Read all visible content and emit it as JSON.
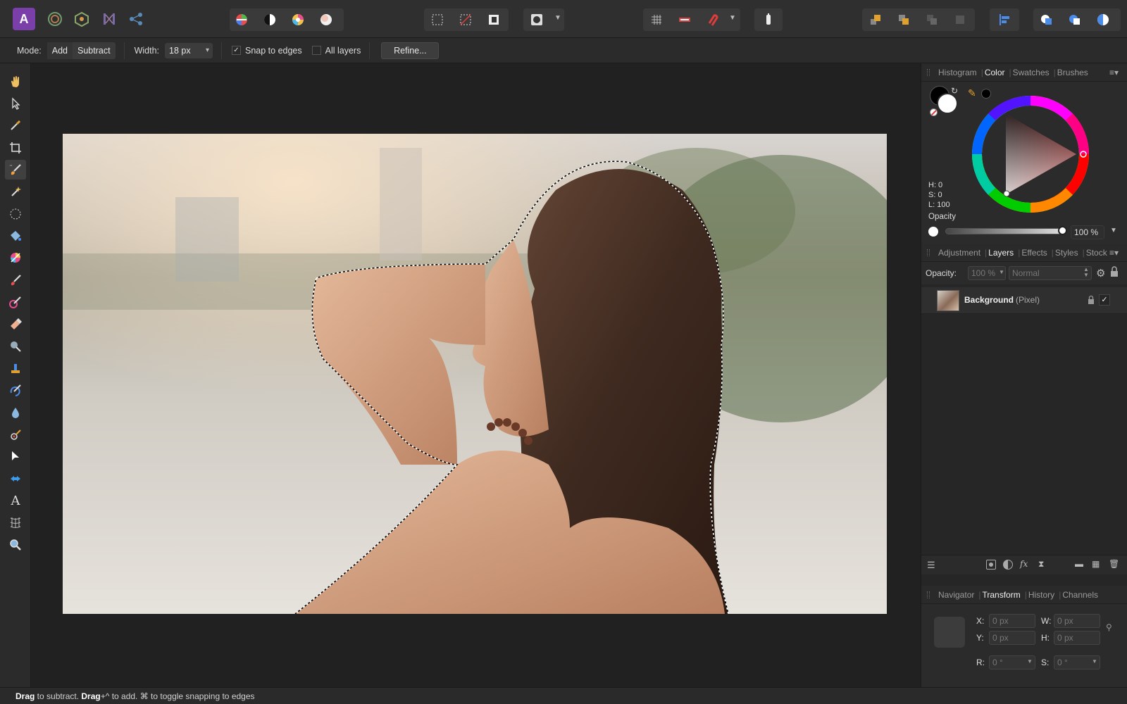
{
  "app": {
    "logo": "A",
    "logo_icon": "affinity-photo-logo"
  },
  "toolbar": {
    "personas": [
      "photo-persona-icon",
      "liquify-persona-icon",
      "develop-persona-icon",
      "tone-mapping-persona-icon",
      "export-persona-icon"
    ],
    "adjust": [
      "auto-levels-icon",
      "auto-contrast-icon",
      "auto-colors-icon",
      "auto-white-balance-icon"
    ],
    "selection": [
      "marquee-icon",
      "deselect-icon",
      "invert-selection-icon"
    ],
    "mask": [
      "quick-mask-icon"
    ],
    "snap": [
      "grid-icon",
      "snapping-ruler-icon",
      "snapping-magnet-icon"
    ],
    "assistant": [
      "assistant-icon"
    ],
    "arrange": [
      "move-to-front-icon",
      "move-forward-icon",
      "move-back-icon",
      "move-to-back-icon"
    ],
    "align": [
      "align-icon"
    ],
    "boolean": [
      "add-icon",
      "subtract-icon",
      "intersect-icon"
    ]
  },
  "context": {
    "mode_label": "Mode:",
    "mode_add": "Add",
    "mode_subtract": "Subtract",
    "width_label": "Width:",
    "width_value": "18 px",
    "snap_label": "Snap to edges",
    "all_layers_label": "All layers",
    "refine_label": "Refine..."
  },
  "tools": [
    "hand-icon",
    "move-icon",
    "color-picker-icon",
    "crop-icon",
    "selection-brush-icon",
    "flood-select-icon",
    "marquee-icon",
    "flood-fill-icon",
    "gradient-icon",
    "paint-brush-icon",
    "color-replacement-icon",
    "erase-brush-icon",
    "dodge-icon",
    "clone-icon",
    "undo-brush-icon",
    "blur-brush-icon",
    "red-eye-icon",
    "node-icon",
    "inpainting-icon",
    "text-icon",
    "mesh-warp-icon",
    "zoom-icon"
  ],
  "panels": {
    "top_tabs": [
      "Histogram",
      "Color",
      "Swatches",
      "Brushes"
    ],
    "top_active": "Color",
    "color": {
      "h": "H: 0",
      "s": "S: 0",
      "l": "L: 100",
      "opacity_label": "Opacity",
      "opacity_value": "100 %",
      "primary": "#000000",
      "secondary": "#ffffff"
    },
    "mid_tabs": [
      "Adjustment",
      "Layers",
      "Effects",
      "Styles",
      "Stock"
    ],
    "mid_active": "Layers",
    "layers": {
      "opacity_label": "Opacity:",
      "opacity_value": "100 %",
      "blend_mode": "Normal",
      "layer_name": "Background",
      "layer_type": "(Pixel)"
    },
    "bottom_tabs": [
      "Navigator",
      "Transform",
      "History",
      "Channels"
    ],
    "bottom_active": "Transform",
    "transform": {
      "x_label": "X:",
      "x_value": "0 px",
      "y_label": "Y:",
      "y_value": "0 px",
      "w_label": "W:",
      "w_value": "0 px",
      "h_label": "H:",
      "h_value": "0 px",
      "r_label": "R:",
      "r_value": "0 °",
      "s_label": "S:",
      "s_value": "0 °"
    }
  },
  "status": {
    "drag1": "Drag",
    "t1": " to subtract. ",
    "drag2": "Drag",
    "t2": "+^ to add. ⌘ to toggle snapping to edges"
  }
}
